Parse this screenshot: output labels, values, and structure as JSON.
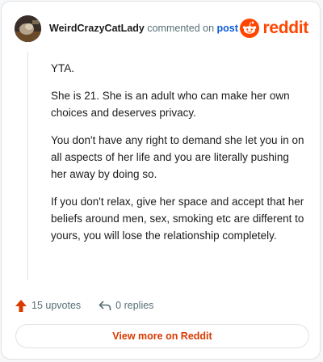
{
  "comment": {
    "username": "WeirdCrazyCatLady",
    "action_text": "commented on",
    "post_link": "post",
    "paragraphs": [
      "YTA.",
      "She is 21. She is an adult who can make her own choices and deserves privacy.",
      "You don't have any right to demand she let you in on all aspects of her life and you are literally pushing her away by doing so.",
      "If you don't relax, give her space and accept that her beliefs around men, sex, smoking etc are different to yours, you will lose the relationship completely."
    ]
  },
  "brand": {
    "name": "reddit",
    "color": "#ff4500"
  },
  "stats": {
    "upvotes": "15 upvotes",
    "replies": "0 replies"
  },
  "footer": {
    "view_more": "View more on Reddit"
  },
  "icons": {
    "upvote": "upvote-arrow-icon",
    "reply": "reply-arrow-icon",
    "logo": "reddit-snoo-icon"
  }
}
